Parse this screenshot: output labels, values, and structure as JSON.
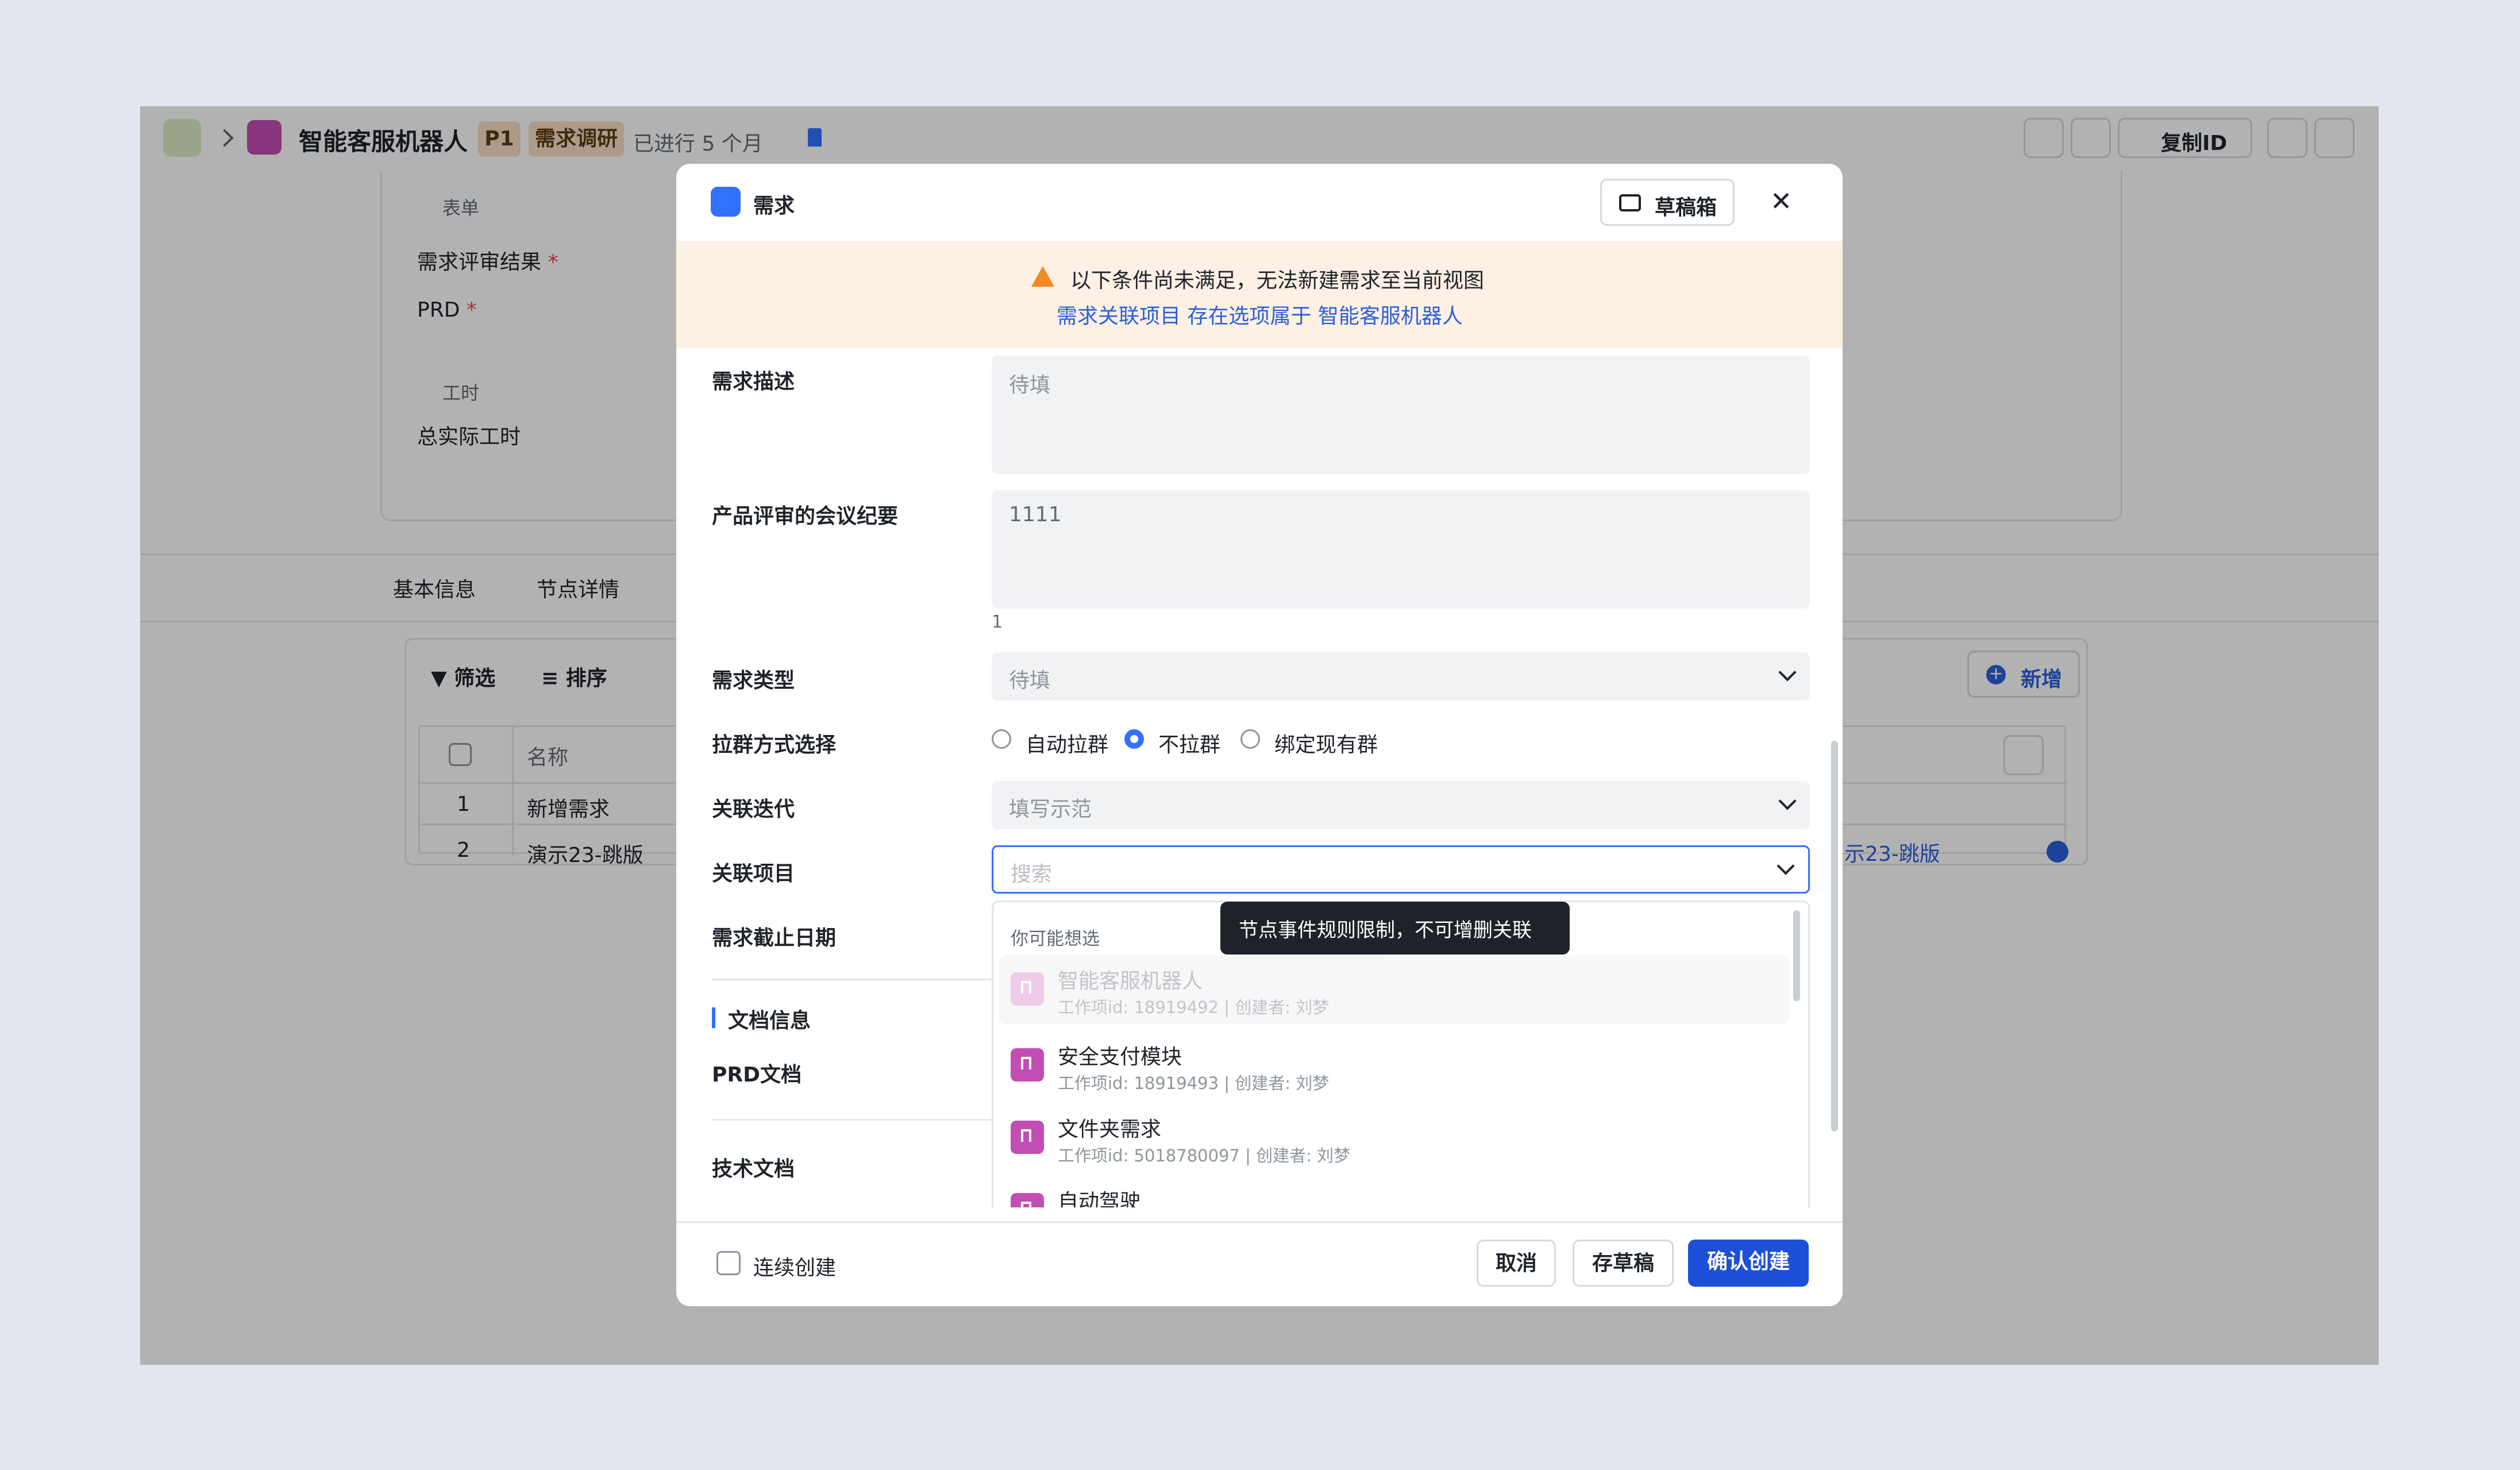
{
  "app": {
    "breadcrumb_title": "智能客服机器人",
    "priority": "P1",
    "stage": "需求调研",
    "elapsed": "已进行 5 个月",
    "copy_id_label": "复制ID",
    "form_section": "表单",
    "review_result_label": "需求评审结果",
    "prd_label": "PRD",
    "required_mark": "*",
    "work_hours_section": "工时",
    "actual_hours_label": "总实际工时",
    "tabs": [
      "基本信息",
      "节点详情"
    ],
    "filter_label": "筛选",
    "sort_label": "排序",
    "add_label": "新增",
    "table_header_name": "名称",
    "rows": [
      {
        "index": "1",
        "name": "新增需求"
      },
      {
        "index": "2",
        "name": "演示23-跳版"
      }
    ],
    "row2_right_link": "示23-跳版"
  },
  "modal": {
    "title": "需求",
    "drafts_label": "草稿箱",
    "warning_text": "以下条件尚未满足，无法新建需求至当前视图",
    "warning_link": "需求关联项目 存在选项属于 智能客服机器人",
    "fields": {
      "description_label": "需求描述",
      "description_placeholder": "待填",
      "meeting_label": "产品评审的会议纪要",
      "meeting_value": "1111",
      "meeting_counter": "1",
      "type_label": "需求类型",
      "type_placeholder": "待填",
      "group_label": "拉群方式选择",
      "group_options": [
        "自动拉群",
        "不拉群",
        "绑定现有群"
      ],
      "group_selected": "不拉群",
      "iteration_label": "关联迭代",
      "iteration_placeholder": "填写示范",
      "project_label": "关联项目",
      "project_placeholder": "搜索",
      "deadline_label": "需求截止日期",
      "doc_section": "文档信息",
      "prd_doc_label": "PRD文档",
      "tech_doc_label": "技术文档"
    },
    "dropdown": {
      "suggest_label": "你可能想选",
      "items": [
        {
          "title": "智能客服机器人",
          "meta": "工作项id: 18919492 | 创建者: 刘梦",
          "disabled": true
        },
        {
          "title": "安全支付模块",
          "meta": "工作项id: 18919493 | 创建者: 刘梦",
          "disabled": false
        },
        {
          "title": "文件夹需求",
          "meta": "工作项id: 5018780097 | 创建者: 刘梦",
          "disabled": false
        },
        {
          "title": "自动驾驶",
          "meta": "",
          "disabled": false
        }
      ]
    },
    "tooltip": "节点事件规则限制，不可增删关联",
    "footer": {
      "continuous_label": "连续创建",
      "cancel_label": "取消",
      "save_draft_label": "存草稿",
      "confirm_label": "确认创建"
    }
  },
  "colors": {
    "accent": "#3370ff",
    "confirm_button": "#1d4fd8",
    "warning_bg": "#fdf0e4",
    "warning_icon": "#f08a24",
    "item_icon": "#c24db3",
    "tooltip_bg": "#1f2329"
  }
}
